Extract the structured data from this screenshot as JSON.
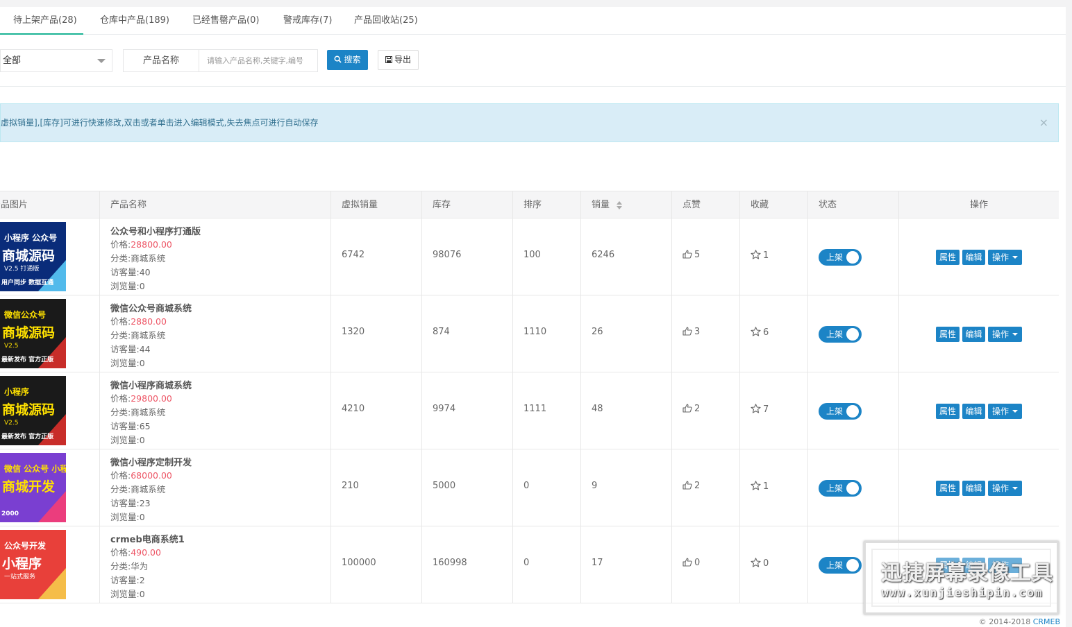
{
  "tabs": [
    {
      "label": "待上架产品(28)"
    },
    {
      "label": "仓库中产品(189)"
    },
    {
      "label": "已经售罄产品(0)"
    },
    {
      "label": "警戒库存(7)"
    },
    {
      "label": "产品回收站(25)"
    }
  ],
  "filters": {
    "category_value": "全部",
    "field_label": "产品名称",
    "search_placeholder": "请输入产品名称,关键字,编号",
    "search_button": "搜索",
    "export_button": "导出"
  },
  "alert": {
    "text": "虚拟销量],[库存]可进行快速修改,双击或者单击进入编辑模式,失去焦点可进行自动保存",
    "close": "×"
  },
  "table": {
    "headers": [
      "产品图片",
      "产品名称",
      "虚拟销量",
      "库存",
      "排序",
      "销量",
      "点赞",
      "收藏",
      "状态",
      "操作"
    ],
    "label_price": "价格:",
    "label_category": "分类:",
    "label_visitors": "访客量:",
    "label_views": "浏览量:",
    "status_label": "上架",
    "op_attr": "属性",
    "op_edit": "编辑",
    "op_more": "操作",
    "rows": [
      {
        "name": "公众号和小程序打通版",
        "price": "28800.00",
        "category": "商城系统",
        "visitors": "40",
        "views": "0",
        "virtual_sales": "6742",
        "stock": "98076",
        "sort": "100",
        "sales": "6246",
        "likes": "5",
        "favorites": "1",
        "image": {
          "line1": "小程序 公众号",
          "line2": "商城源码",
          "line3": "V2.5 打通版",
          "line4": "用户同步 数据互通",
          "bg": "#0a2c7a",
          "fg": "#ffffff",
          "accent": "#5fd3ff"
        }
      },
      {
        "name": "微信公众号商城系统",
        "price": "2880.00",
        "category": "商城系统",
        "visitors": "44",
        "views": "0",
        "virtual_sales": "1320",
        "stock": "874",
        "sort": "1110",
        "sales": "26",
        "likes": "3",
        "favorites": "6",
        "image": {
          "line1": "微信公众号",
          "line2": "商城源码",
          "line3": "V2.5",
          "line4": "最新发布 官方正版",
          "bg": "#1a1a1a",
          "fg": "#ffe100",
          "accent": "#e8312d"
        }
      },
      {
        "name": "微信小程序商城系统",
        "price": "29800.00",
        "category": "商城系统",
        "visitors": "65",
        "views": "0",
        "virtual_sales": "4210",
        "stock": "9974",
        "sort": "1111",
        "sales": "48",
        "likes": "2",
        "favorites": "7",
        "image": {
          "line1": "小程序",
          "line2": "商城源码",
          "line3": "V2.5",
          "line4": "最新发布 官方正版",
          "bg": "#1a1a1a",
          "fg": "#ffe100",
          "accent": "#e8312d"
        }
      },
      {
        "name": "微信小程序定制开发",
        "price": "68000.00",
        "category": "商城系统",
        "visitors": "23",
        "views": "0",
        "virtual_sales": "210",
        "stock": "5000",
        "sort": "0",
        "sales": "9",
        "likes": "2",
        "favorites": "1",
        "image": {
          "line1": "微信 公众号 小程序",
          "line2": "商城开发",
          "line3": "",
          "line4": "2000",
          "bg": "#7a3fd1",
          "fg": "#ffe100",
          "accent": "#ff3d6e"
        }
      },
      {
        "name": "crmeb电商系统1",
        "price": "490.00",
        "category": "华为",
        "visitors": "2",
        "views": "0",
        "virtual_sales": "100000",
        "stock": "160998",
        "sort": "0",
        "sales": "17",
        "likes": "0",
        "favorites": "0",
        "image": {
          "line1": "公众号开发",
          "line2": "小程序",
          "line3": "一站式服务",
          "line4": "",
          "bg": "#e8403a",
          "fg": "#ffffff",
          "accent": "#f7d44c"
        }
      }
    ]
  },
  "watermark": {
    "title": "迅捷屏幕录像工具",
    "url": "www.xunjieshipin.com"
  },
  "footer": {
    "copyright": "© 2014-2018 ",
    "brand": "CRMEB"
  },
  "colors": {
    "primary": "#1c84c6",
    "price": "#ed5565",
    "alert_bg": "#d9edf7"
  }
}
